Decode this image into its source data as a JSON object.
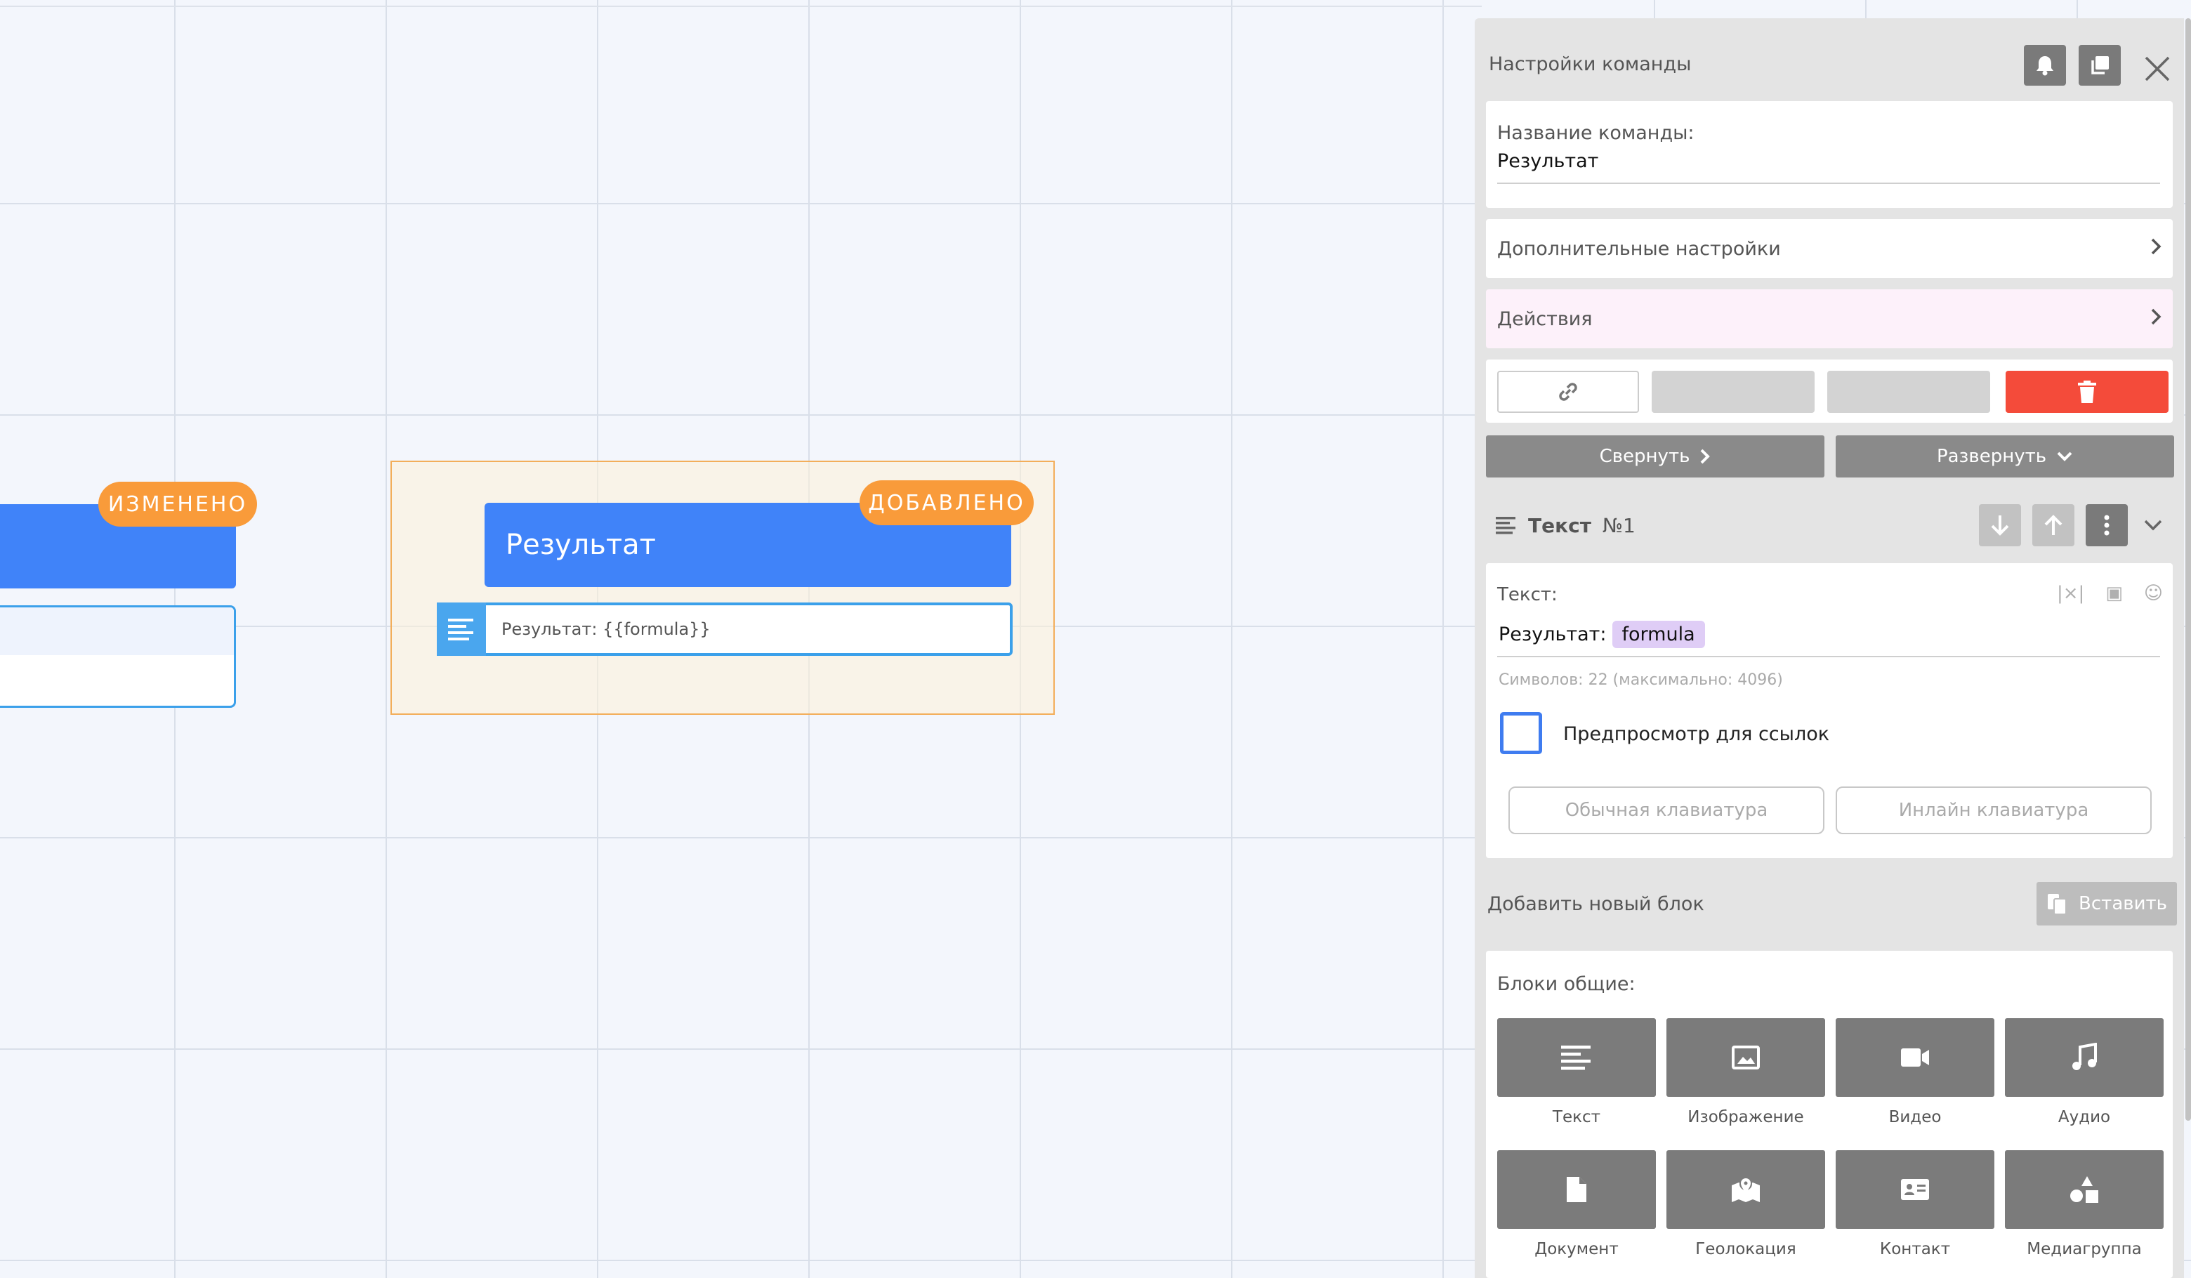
{
  "canvas": {
    "left_node": {
      "badge": "ИЗМЕНЕНО"
    },
    "added_node": {
      "badge": "ДОБАВЛЕНО",
      "title": "Результат",
      "row_text": "Результат: {{formula}}"
    }
  },
  "panel": {
    "title": "Настройки команды",
    "name_label": "Название команды:",
    "name_value": "Результат",
    "extra_settings": "Дополнительные настройки",
    "actions": "Действия",
    "collapse": "Свернуть",
    "expand": "Развернуть",
    "block_type": "Текст",
    "block_number": "№1",
    "text_label": "Текст:",
    "text_prefix": "Результат:",
    "text_variable": "formula",
    "char_count": "Символов: 22 (максимально: 4096)",
    "preview_label": "Предпросмотр для ссылок",
    "normal_keyboard": "Обычная клавиатура",
    "inline_keyboard": "Инлайн клавиатура",
    "add_block": "Добавить новый блок",
    "paste": "Вставить",
    "blocks_title": "Блоки общие:",
    "blocks": [
      {
        "label": "Текст",
        "icon": "text-icon"
      },
      {
        "label": "Изображение",
        "icon": "image-icon"
      },
      {
        "label": "Видео",
        "icon": "video-icon"
      },
      {
        "label": "Аудио",
        "icon": "music-icon"
      },
      {
        "label": "Документ",
        "icon": "document-icon"
      },
      {
        "label": "Геолокация",
        "icon": "map-icon"
      },
      {
        "label": "Контакт",
        "icon": "contact-icon"
      },
      {
        "label": "Медиагруппа",
        "icon": "shapes-icon"
      }
    ]
  },
  "colors": {
    "node_blue": "#4083f9",
    "badge_orange": "#f99b3a",
    "delete_red": "#f44b3a",
    "chip_purple": "#dfcdf6"
  }
}
